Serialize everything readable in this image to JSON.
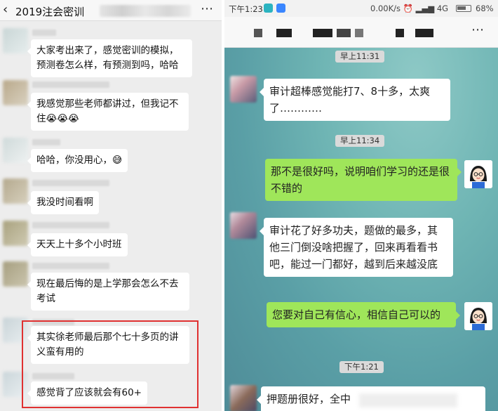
{
  "left_chat": {
    "back_icon": "chevron-left-icon",
    "title": "2019注会密训",
    "more_icon": "ellipsis-icon",
    "messages": [
      {
        "text": "大家考出来了，感觉密训的模拟，预测卷怎么样，有预测到吗，哈哈"
      },
      {
        "text": "我感觉那些老师都讲过，但我记不住😭😭😭"
      },
      {
        "text": "哈哈，你没用心，😅"
      },
      {
        "text": "我没时间看啊"
      },
      {
        "text": "天天上十多个小时班"
      },
      {
        "text": "现在最后悔的是上学那会怎么不去考试"
      },
      {
        "text": "其实徐老师最后那个七十多页的讲义蛮有用的"
      },
      {
        "text": "感觉背了应该就会有60+"
      }
    ],
    "highlight_color": "#e03131"
  },
  "right_chat": {
    "status": {
      "time": "下午1:23",
      "network": "0.00K/s",
      "signal_label": "4G",
      "battery_pct": "68%",
      "battery_level": 0.68
    },
    "menu_icon": "ellipsis-icon",
    "timestamps": [
      "早上11:31",
      "早上11:34",
      "下午1:21"
    ],
    "messages": [
      {
        "side": "in",
        "text": "审计超棒感觉能打7、8十多，太爽了…………"
      },
      {
        "side": "out",
        "text": "那不是很好吗，说明咱们学习的还是很不错的"
      },
      {
        "side": "in",
        "text": "审计花了好多功夫，题做的最多，其他三门倒没啥把握了，回来再看看书吧，能过一门都好，越到后来越没底"
      },
      {
        "side": "out",
        "text": "您要对自己有信心，相信自己可以的"
      },
      {
        "side": "in",
        "text": "押题册很好，全中"
      }
    ],
    "bubble_out_color": "#9fe65a"
  }
}
